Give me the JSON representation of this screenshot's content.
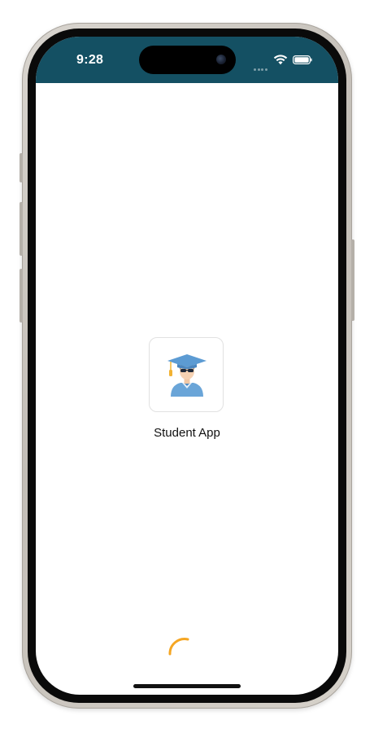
{
  "status_bar": {
    "time": "9:28",
    "background_color": "#145063",
    "icons": [
      "cellular-signal-icon",
      "wifi-icon",
      "battery-icon"
    ]
  },
  "splash": {
    "app_icon": "graduate-student-icon",
    "app_name": "Student App",
    "loading_indicator": "loading-spinner",
    "spinner_color": "#f5a623"
  },
  "colors": {
    "status_bar": "#145063",
    "screen_background": "#ffffff",
    "spinner": "#f5a623"
  }
}
